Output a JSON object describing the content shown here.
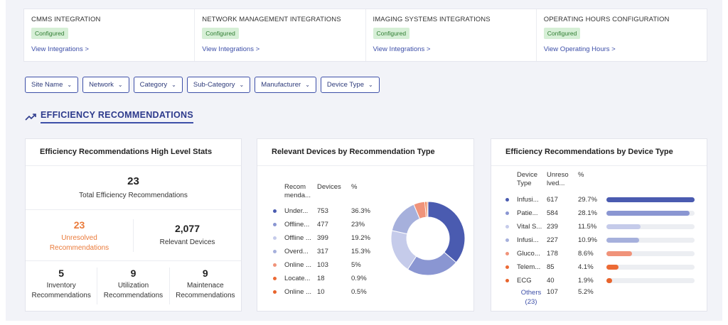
{
  "integrations": [
    {
      "title": "CMMS INTEGRATION",
      "status": "Configured",
      "link": "View Integrations >"
    },
    {
      "title": "NETWORK MANAGEMENT INTEGRATIONS",
      "status": "Configured",
      "link": "View Integrations >"
    },
    {
      "title": "IMAGING SYSTEMS INTEGRATIONS",
      "status": "Configured",
      "link": "View Integrations >"
    },
    {
      "title": "OPERATING HOURS CONFIGURATION",
      "status": "Configured",
      "link": "View Operating Hours >"
    }
  ],
  "filters": [
    "Site Name",
    "Network",
    "Category",
    "Sub-Category",
    "Manufacturer",
    "Device Type"
  ],
  "section": {
    "title": "EFFICIENCY RECOMMENDATIONS",
    "icon": "trend-up-icon"
  },
  "stats_card": {
    "title": "Efficiency Recommendations High Level Stats",
    "total_value": "23",
    "total_label": "Total Efficiency Recommendations",
    "unresolved_value": "23",
    "unresolved_label_1": "Unresolved",
    "unresolved_label_2": "Recommendations",
    "devices_value": "2,077",
    "devices_label": "Relevant Devices",
    "inventory_value": "5",
    "inventory_label_1": "Inventory",
    "inventory_label_2": "Recommendations",
    "utilization_value": "9",
    "utilization_label_1": "Utilization",
    "utilization_label_2": "Recommendations",
    "maintenance_value": "9",
    "maintenance_label_1": "Maintenace",
    "maintenance_label_2": "Recommendations"
  },
  "rec_card": {
    "title": "Relevant Devices by Recommendation Type",
    "headers": {
      "type_1": "Recom",
      "type_2": "menda...",
      "devices": "Devices",
      "pct": "%"
    },
    "rows": [
      {
        "label": "Under...",
        "devices": "753",
        "pct": "36.3%",
        "color": "#4a5bb0"
      },
      {
        "label": "Offline...",
        "devices": "477",
        "pct": "23%",
        "color": "#8a96d2"
      },
      {
        "label": "Offline ...",
        "devices": "399",
        "pct": "19.2%",
        "color": "#c5cbea"
      },
      {
        "label": "Overd...",
        "devices": "317",
        "pct": "15.3%",
        "color": "#a6b0dc"
      },
      {
        "label": "Online ...",
        "devices": "103",
        "pct": "5%",
        "color": "#f0937a"
      },
      {
        "label": "Locate...",
        "devices": "18",
        "pct": "0.9%",
        "color": "#ec6a35"
      },
      {
        "label": "Online ...",
        "devices": "10",
        "pct": "0.5%",
        "color": "#e8642c"
      }
    ]
  },
  "chart_data": {
    "type": "pie",
    "title": "Relevant Devices by Recommendation Type",
    "categories": [
      "Under...",
      "Offline...",
      "Offline ...",
      "Overd...",
      "Online ...",
      "Locate...",
      "Online ..."
    ],
    "values": [
      753,
      477,
      399,
      317,
      103,
      18,
      10
    ],
    "colors": [
      "#4a5bb0",
      "#8a96d2",
      "#c5cbea",
      "#a6b0dc",
      "#f0937a",
      "#ec6a35",
      "#e8642c"
    ],
    "donut": true
  },
  "device_card": {
    "title": "Efficiency Recommendations by Device Type",
    "headers": {
      "type_1": "Device",
      "type_2": "Type",
      "unres_1": "Unreso",
      "unres_2": "lved...",
      "pct": "%"
    },
    "rows": [
      {
        "label": "Infusi...",
        "count": "617",
        "pct": "29.7%",
        "fraction": 1.0,
        "color": "#4a5bb0"
      },
      {
        "label": "Patie...",
        "count": "584",
        "pct": "28.1%",
        "fraction": 0.946,
        "color": "#8a96d2"
      },
      {
        "label": "Vital S...",
        "count": "239",
        "pct": "11.5%",
        "fraction": 0.387,
        "color": "#c5cbea"
      },
      {
        "label": "Infusi...",
        "count": "227",
        "pct": "10.9%",
        "fraction": 0.368,
        "color": "#a6b0dc"
      },
      {
        "label": "Gluco...",
        "count": "178",
        "pct": "8.6%",
        "fraction": 0.288,
        "color": "#f0937a"
      },
      {
        "label": "Telem...",
        "count": "85",
        "pct": "4.1%",
        "fraction": 0.138,
        "color": "#ec6a35"
      },
      {
        "label": "ECG",
        "count": "40",
        "pct": "1.9%",
        "fraction": 0.065,
        "color": "#e8642c"
      }
    ],
    "others_label_1": "Others",
    "others_label_2": "(23)",
    "others_count": "107",
    "others_pct": "5.2%"
  }
}
